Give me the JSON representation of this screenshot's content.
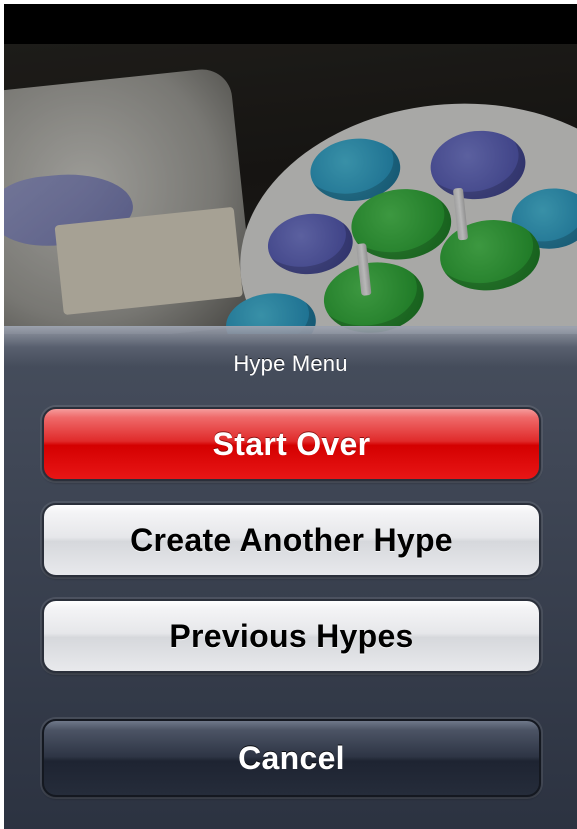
{
  "sheet": {
    "title": "Hype Menu",
    "buttons": {
      "start_over": "Start Over",
      "create_another": "Create Another Hype",
      "previous": "Previous Hypes",
      "cancel": "Cancel"
    }
  },
  "colors": {
    "destructive_button": "#d40000",
    "default_button": "#e6e7ea",
    "cancel_button": "#2e3545",
    "sheet_background": "#4a5262"
  }
}
